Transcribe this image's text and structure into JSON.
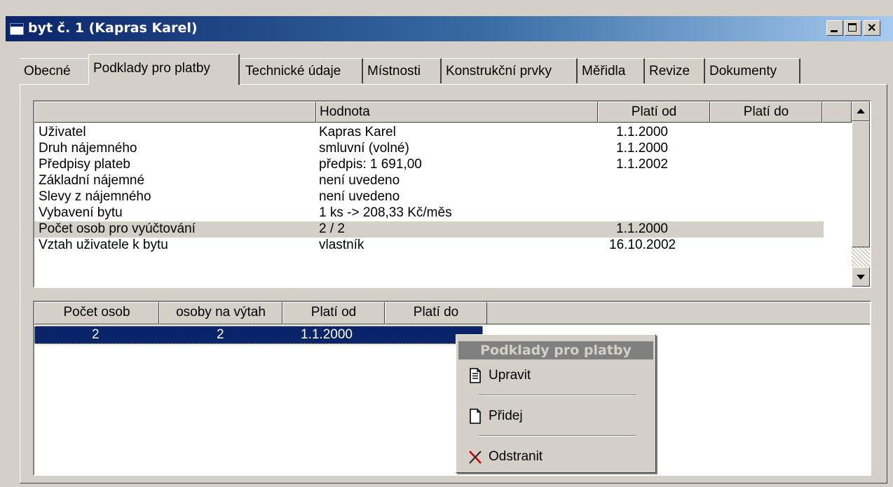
{
  "window": {
    "title": "byt č. 1 (Kapras Karel)"
  },
  "tabs": [
    {
      "label": "Obecné"
    },
    {
      "label": "Podklady pro platby"
    },
    {
      "label": "Technické údaje"
    },
    {
      "label": "Místnosti"
    },
    {
      "label": "Konstrukční prvky"
    },
    {
      "label": "Měřidla"
    },
    {
      "label": "Revize"
    },
    {
      "label": "Dokumenty"
    }
  ],
  "active_tab": "Podklady pro platby",
  "grid1": {
    "columns": [
      "",
      "Hodnota",
      "Platí od",
      "Platí do"
    ],
    "rows": [
      {
        "name": "Uživatel",
        "value": "Kapras Karel",
        "from": "1.1.2000",
        "to": ""
      },
      {
        "name": "Druh nájemného",
        "value": "smluvní (volné)",
        "from": "1.1.2000",
        "to": ""
      },
      {
        "name": "Předpisy plateb",
        "value": "předpis: 1 691,00",
        "from": "1.1.2002",
        "to": ""
      },
      {
        "name": "Základní nájemné",
        "value": "není uvedeno",
        "from": "",
        "to": ""
      },
      {
        "name": "Slevy z nájemného",
        "value": "není uvedeno",
        "from": "",
        "to": ""
      },
      {
        "name": "Vybavení bytu",
        "value": "1 ks -> 208,33 Kč/měs",
        "from": "",
        "to": ""
      },
      {
        "name": "Počet osob pro vyúčtování",
        "value": "2 / 2",
        "from": "1.1.2000",
        "to": ""
      },
      {
        "name": "Vztah uživatele k bytu",
        "value": "vlastník",
        "from": "16.10.2002",
        "to": ""
      }
    ]
  },
  "grid2": {
    "columns": [
      "Počet osob",
      "osoby na výtah",
      "Platí od",
      "Platí do"
    ],
    "rows": [
      {
        "persons": "2",
        "elevator": "2",
        "from": "1.1.2000",
        "to": ""
      }
    ]
  },
  "context_menu": {
    "title": "Podklady pro platby",
    "items": [
      {
        "label": "Upravit",
        "icon": "edit-document-icon"
      },
      {
        "label": "Přidej",
        "icon": "new-document-icon"
      },
      {
        "label": "Odstranit",
        "icon": "delete-x-icon"
      }
    ]
  }
}
